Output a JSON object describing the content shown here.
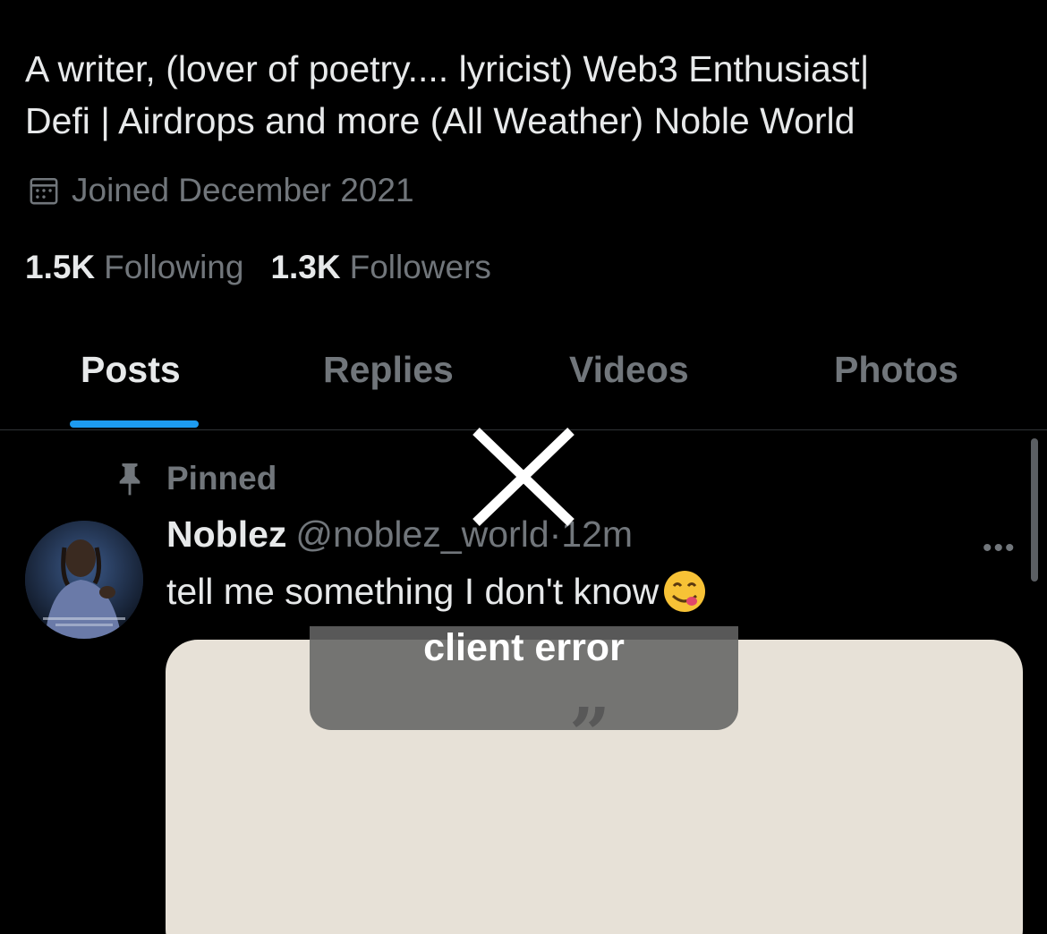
{
  "profile": {
    "bio_line1": "A writer, (lover of poetry.... lyricist) Web3 Enthusiast|",
    "bio_line2": "Defi | Airdrops and more (All Weather) Noble World",
    "joined": "Joined December 2021",
    "following_count": "1.5K",
    "following_label": "Following",
    "followers_count": "1.3K",
    "followers_label": "Followers"
  },
  "tabs": [
    {
      "label": "Posts",
      "active": true
    },
    {
      "label": "Replies",
      "active": false
    },
    {
      "label": "Videos",
      "active": false
    },
    {
      "label": "Photos",
      "active": false
    }
  ],
  "post": {
    "pinned_label": "Pinned",
    "name": "Noblez",
    "handle": "@noblez_world",
    "separator": "·",
    "time": "12m",
    "text": "tell me something I don't know",
    "more": "•••",
    "media_quote": "”"
  },
  "overlay": {
    "error_text": "client error",
    "close_icon": "close-icon"
  },
  "colors": {
    "background": "#000000",
    "text_primary": "#e7e9ea",
    "text_secondary": "#71767b",
    "accent": "#1d9bf0"
  }
}
